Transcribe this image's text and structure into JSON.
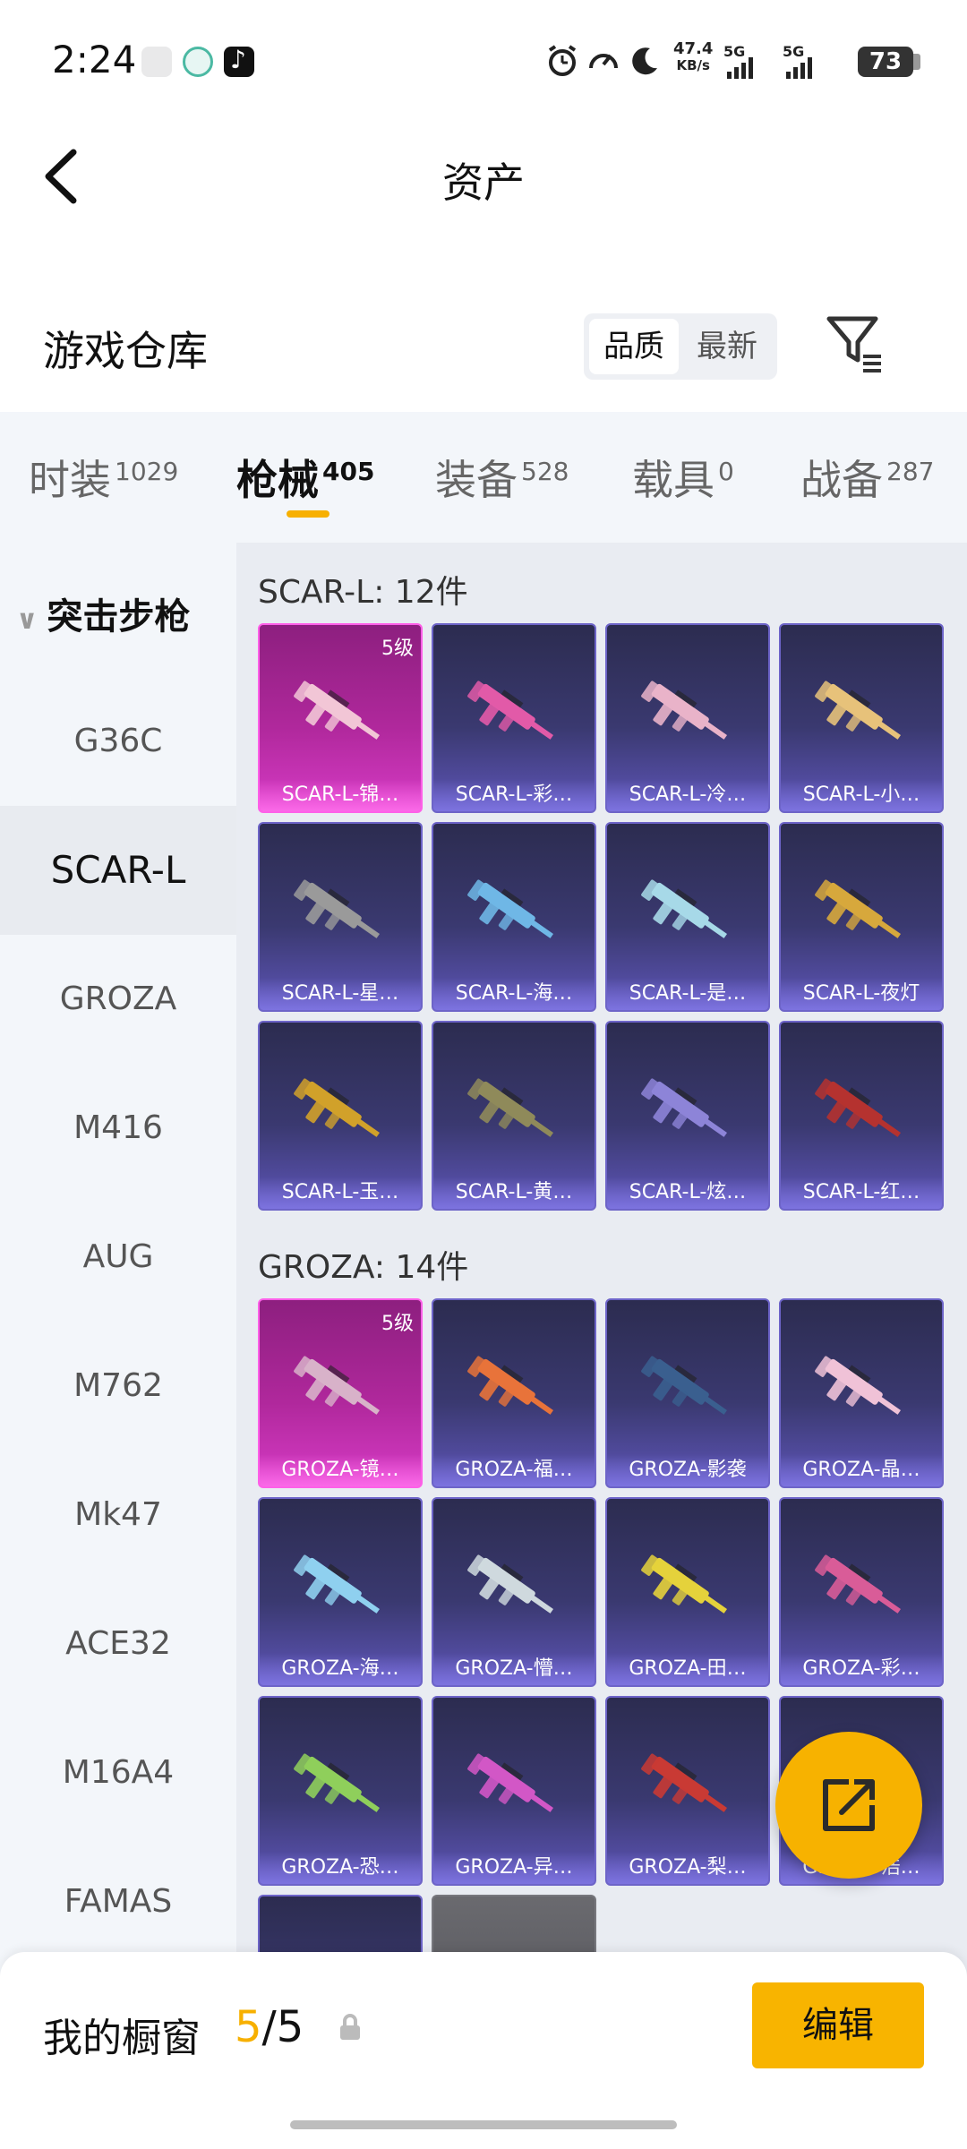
{
  "status_bar": {
    "time": "2:24",
    "net_speed": "47.4",
    "net_unit": "KB/s",
    "sig1": "5G",
    "sig2": "5G",
    "battery": "73"
  },
  "header": {
    "title": "资产"
  },
  "warehouse": {
    "title": "游戏仓库",
    "sort_options": [
      "品质",
      "最新"
    ]
  },
  "tabs": [
    {
      "label": "时装",
      "count": "1029"
    },
    {
      "label": "枪械",
      "count": "405"
    },
    {
      "label": "装备",
      "count": "528"
    },
    {
      "label": "载具",
      "count": "0"
    },
    {
      "label": "战备",
      "count": "287"
    }
  ],
  "sidebar": {
    "category": "突击步枪",
    "items": [
      "G36C",
      "SCAR-L",
      "GROZA",
      "M416",
      "AUG",
      "M762",
      "Mk47",
      "ACE32",
      "M16A4",
      "FAMAS"
    ]
  },
  "sections": [
    {
      "title": "SCAR-L: 12件",
      "items": [
        {
          "label": "SCAR-L-锦…",
          "badge": "5级",
          "rarity": "gold",
          "color": "#f2c6d6"
        },
        {
          "label": "SCAR-L-彩…",
          "badge": "",
          "rarity": "purple",
          "color": "#e25aa8"
        },
        {
          "label": "SCAR-L-冷…",
          "badge": "",
          "rarity": "purple",
          "color": "#e9b3c9"
        },
        {
          "label": "SCAR-L-小…",
          "badge": "",
          "rarity": "purple",
          "color": "#e7c27a"
        },
        {
          "label": "SCAR-L-星…",
          "badge": "",
          "rarity": "purple",
          "color": "#9a9a9a"
        },
        {
          "label": "SCAR-L-海…",
          "badge": "",
          "rarity": "purple",
          "color": "#6fb7e6"
        },
        {
          "label": "SCAR-L-是…",
          "badge": "",
          "rarity": "purple",
          "color": "#a7d9e8"
        },
        {
          "label": "SCAR-L-夜灯",
          "badge": "",
          "rarity": "purple",
          "color": "#d7a83c"
        },
        {
          "label": "SCAR-L-玉…",
          "badge": "",
          "rarity": "purple",
          "color": "#d1a12a"
        },
        {
          "label": "SCAR-L-黄…",
          "badge": "",
          "rarity": "purple",
          "color": "#8f8a5a"
        },
        {
          "label": "SCAR-L-炫…",
          "badge": "",
          "rarity": "purple",
          "color": "#8d84d8"
        },
        {
          "label": "SCAR-L-红…",
          "badge": "",
          "rarity": "purple",
          "color": "#b5322f"
        }
      ]
    },
    {
      "title": "GROZA: 14件",
      "items": [
        {
          "label": "GROZA-镜…",
          "badge": "5级",
          "rarity": "gold",
          "color": "#d8b2c9"
        },
        {
          "label": "GROZA-福…",
          "badge": "",
          "rarity": "purple",
          "color": "#e8733a"
        },
        {
          "label": "GROZA-影袭",
          "badge": "",
          "rarity": "purple",
          "color": "#3a5f8f"
        },
        {
          "label": "GROZA-晶…",
          "badge": "",
          "rarity": "purple",
          "color": "#f0c2d7"
        },
        {
          "label": "GROZA-海…",
          "badge": "",
          "rarity": "purple",
          "color": "#8fd0ef"
        },
        {
          "label": "GROZA-懵…",
          "badge": "",
          "rarity": "purple",
          "color": "#cfd9de"
        },
        {
          "label": "GROZA-田…",
          "badge": "",
          "rarity": "purple",
          "color": "#e5d23b"
        },
        {
          "label": "GROZA-彩…",
          "badge": "",
          "rarity": "purple",
          "color": "#d95c98"
        },
        {
          "label": "GROZA-恐…",
          "badge": "",
          "rarity": "purple",
          "color": "#8fcf5b"
        },
        {
          "label": "GROZA-异…",
          "badge": "",
          "rarity": "purple",
          "color": "#d257c6"
        },
        {
          "label": "GROZA-梨…",
          "badge": "",
          "rarity": "purple",
          "color": "#c93a34"
        },
        {
          "label": "GROZA-浩…",
          "badge": "",
          "rarity": "purple",
          "color": "#cfcfcf"
        },
        {
          "label": "",
          "badge": "",
          "rarity": "purple",
          "color": "#b44a3a"
        },
        {
          "label": "",
          "badge": "",
          "rarity": "grey",
          "color": "#d2c56a"
        }
      ]
    }
  ],
  "showcase": {
    "label": "我的橱窗",
    "current": "5",
    "separator": "/",
    "total": "5",
    "edit_label": "编辑"
  },
  "colors": {
    "accent": "#f7b000",
    "gold_card": "#b0289c",
    "purple_card": "#3a3970"
  }
}
